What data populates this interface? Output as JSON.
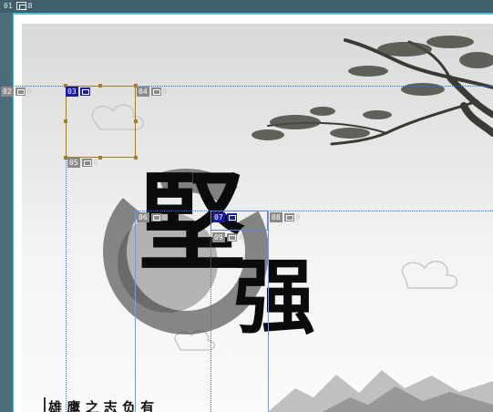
{
  "editor": {
    "top_tag": {
      "num": "01",
      "count": "8"
    },
    "left_tag": {
      "num": "02",
      "count": "8"
    }
  },
  "slide": {
    "title_char_1": "堅",
    "title_char_2": "强",
    "bottom_text": "雄 鹰 之 志   负 有"
  },
  "tags": [
    {
      "num": "03",
      "count": "",
      "selected": true
    },
    {
      "num": "04",
      "count": "8"
    },
    {
      "num": "05",
      "count": "8"
    },
    {
      "num": "06",
      "count": "8"
    },
    {
      "num": "07",
      "count": "",
      "selected": true
    },
    {
      "num": "08",
      "count": "8"
    },
    {
      "num": "09",
      "count": "8"
    }
  ],
  "colors": {
    "frame": "#4fc3d6",
    "selection": "#a37c2c",
    "guide": "#3b6fd1",
    "tag_selected": "#1c1ca0"
  }
}
